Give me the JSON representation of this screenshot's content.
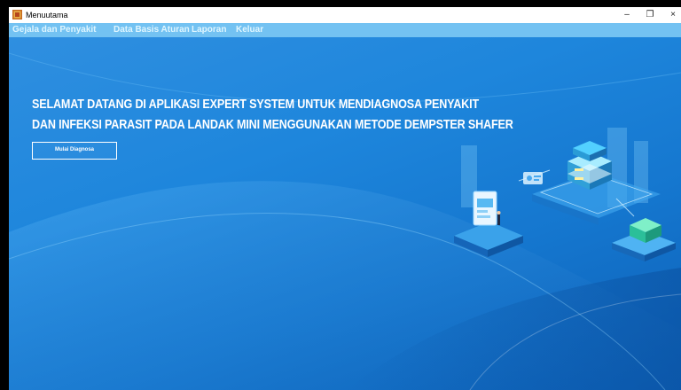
{
  "window": {
    "title": "Menuutama",
    "minimize": "–",
    "restore": "❐",
    "close": "×"
  },
  "menu": {
    "items": [
      {
        "label": "Gejala dan Penyakit"
      },
      {
        "label": "Data Basis Aturan"
      },
      {
        "label": "Laporan"
      },
      {
        "label": "Keluar"
      }
    ]
  },
  "main": {
    "headline_line1": "SELAMAT DATANG DI APLIKASI EXPERT SYSTEM UNTUK MENDIAGNOSA PENYAKIT",
    "headline_line2": "DAN INFEKSI PARASIT PADA LANDAK MINI MENGGUNAKAN METODE DEMPSTER SHAFER",
    "start_button_label": "Mulai Diagnosa"
  },
  "colors": {
    "accent": "#1e86dc",
    "menu_bar": "#73c2f2"
  }
}
